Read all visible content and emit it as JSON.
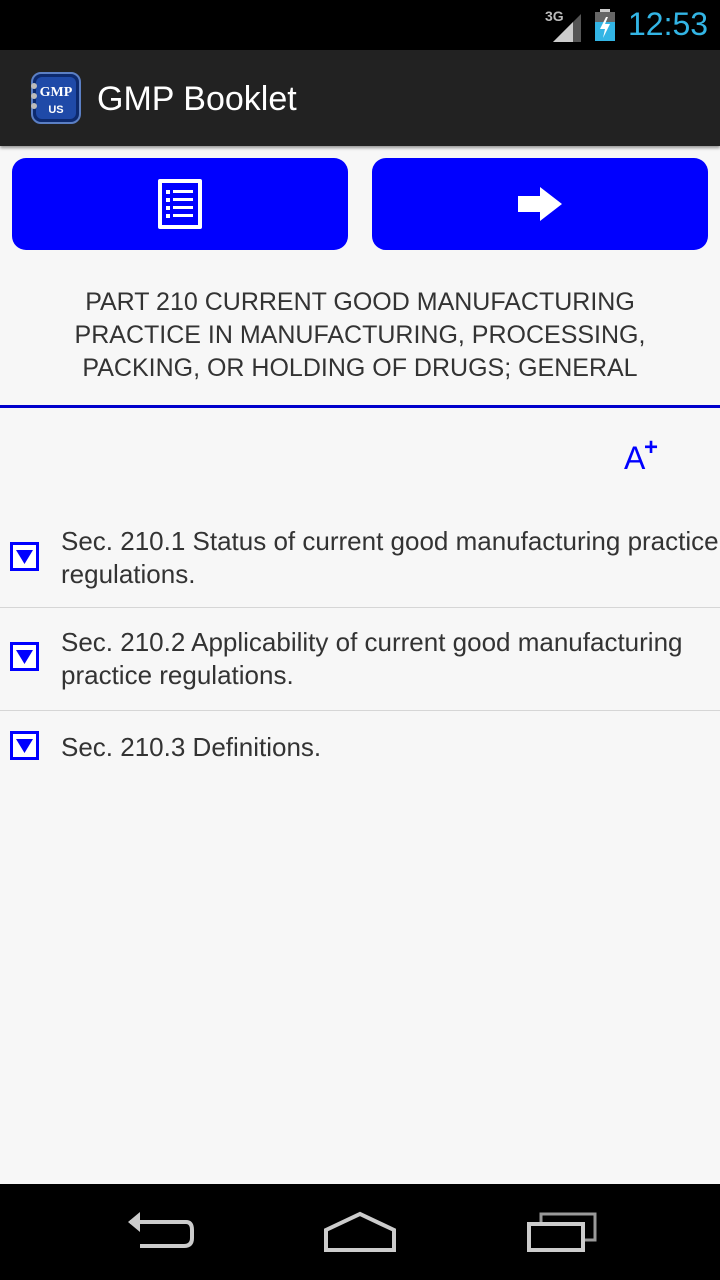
{
  "status_bar": {
    "network": "3G",
    "time": "12:53"
  },
  "action_bar": {
    "title": "GMP Booklet",
    "icon_text_top": "GMP",
    "icon_text_bottom": "US"
  },
  "toolbar": {
    "list_button_icon": "list-icon",
    "next_button_icon": "arrow-right-icon"
  },
  "part_title": "PART 210 CURRENT GOOD MANUFACTURING PRACTICE IN MANUFACTURING, PROCESSING, PACKING, OR HOLDING OF DRUGS; GENERAL",
  "font_button": {
    "letter": "A",
    "plus": "+"
  },
  "sections": [
    {
      "label": "Sec. 210.1 Status of current good manufacturing practice regulations."
    },
    {
      "label": "Sec. 210.2 Applicability of current good manufacturing practice regulations."
    },
    {
      "label": "Sec. 210.3 Definitions."
    }
  ],
  "colors": {
    "accent": "#0000ff",
    "status_time": "#33b5e5",
    "action_bar": "#222222"
  }
}
